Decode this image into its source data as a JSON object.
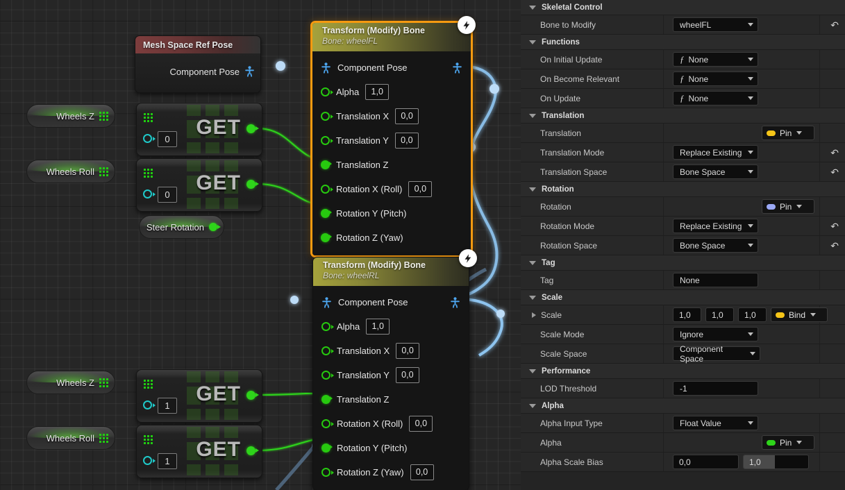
{
  "graph": {
    "variables": [
      {
        "name": "Wheels Z",
        "pin": "array-grid-pin"
      },
      {
        "name": "Wheels Roll",
        "pin": "array-grid-pin"
      },
      {
        "name": "Steer Rotation",
        "pin": "float-dot-pin"
      },
      {
        "name": "Wheels Z",
        "pin": "array-grid-pin"
      },
      {
        "name": "Wheels Roll",
        "pin": "array-grid-pin"
      }
    ],
    "get_nodes": [
      {
        "label": "GET",
        "index": "0"
      },
      {
        "label": "GET",
        "index": "0"
      },
      {
        "label": "GET",
        "index": "1"
      },
      {
        "label": "GET",
        "index": "1"
      }
    ],
    "ref_pose_node": {
      "title": "Mesh Space Ref Pose",
      "out_pin_label": "Component Pose"
    },
    "transform_nodes": [
      {
        "title": "Transform (Modify) Bone",
        "subtitle": "Bone: wheelFL",
        "selected": true,
        "pose_in": "Component Pose",
        "pins": [
          {
            "label": "Alpha",
            "value": "1,0",
            "connected": false
          },
          {
            "label": "Translation X",
            "value": "0,0",
            "connected": false
          },
          {
            "label": "Translation Y",
            "value": "0,0",
            "connected": false
          },
          {
            "label": "Translation Z",
            "value": null,
            "connected": true
          },
          {
            "label": "Rotation X (Roll)",
            "value": "0,0",
            "connected": false
          },
          {
            "label": "Rotation Y (Pitch)",
            "value": null,
            "connected": true
          },
          {
            "label": "Rotation Z (Yaw)",
            "value": null,
            "connected": true
          }
        ]
      },
      {
        "title": "Transform (Modify) Bone",
        "subtitle": "Bone: wheelRL",
        "selected": false,
        "pose_in": "Component Pose",
        "pins": [
          {
            "label": "Alpha",
            "value": "1,0",
            "connected": false
          },
          {
            "label": "Translation X",
            "value": "0,0",
            "connected": false
          },
          {
            "label": "Translation Y",
            "value": "0,0",
            "connected": false
          },
          {
            "label": "Translation Z",
            "value": null,
            "connected": true
          },
          {
            "label": "Rotation X (Roll)",
            "value": "0,0",
            "connected": false
          },
          {
            "label": "Rotation Y (Pitch)",
            "value": null,
            "connected": true
          },
          {
            "label": "Rotation Z (Yaw)",
            "value": "0,0",
            "connected": false
          }
        ]
      }
    ]
  },
  "details": {
    "sections": [
      {
        "title": "Skeletal Control",
        "rows": [
          {
            "name": "Bone to Modify",
            "type": "combo",
            "value": "wheelFL",
            "revert": true
          }
        ]
      },
      {
        "title": "Functions",
        "rows": [
          {
            "name": "On Initial Update",
            "type": "func-combo",
            "value": "None",
            "revert": false
          },
          {
            "name": "On Become Relevant",
            "type": "func-combo",
            "value": "None",
            "revert": false
          },
          {
            "name": "On Update",
            "type": "func-combo",
            "value": "None",
            "revert": false
          }
        ]
      },
      {
        "title": "Translation",
        "rows": [
          {
            "name": "Translation",
            "type": "pin",
            "value": "Pin",
            "color": "#f5c518",
            "revert": false
          },
          {
            "name": "Translation Mode",
            "type": "combo",
            "value": "Replace Existing",
            "revert": true
          },
          {
            "name": "Translation Space",
            "type": "combo",
            "value": "Bone Space",
            "revert": true
          }
        ]
      },
      {
        "title": "Rotation",
        "rows": [
          {
            "name": "Rotation",
            "type": "pin",
            "value": "Pin",
            "color": "#9aa8f5",
            "revert": false
          },
          {
            "name": "Rotation Mode",
            "type": "combo",
            "value": "Replace Existing",
            "revert": true
          },
          {
            "name": "Rotation Space",
            "type": "combo",
            "value": "Bone Space",
            "revert": true
          }
        ]
      },
      {
        "title": "Tag",
        "rows": [
          {
            "name": "Tag",
            "type": "text",
            "value": "None",
            "revert": false
          }
        ]
      },
      {
        "title": "Scale",
        "rows": [
          {
            "name": "Scale",
            "type": "vector-bind",
            "values": [
              "1,0",
              "1,0",
              "1,0"
            ],
            "bind_label": "Bind",
            "color": "#f5c518",
            "expandable": true,
            "revert": false
          },
          {
            "name": "Scale Mode",
            "type": "combo",
            "value": "Ignore",
            "revert": false
          },
          {
            "name": "Scale Space",
            "type": "combo",
            "value": "Component Space",
            "revert": false
          }
        ]
      },
      {
        "title": "Performance",
        "rows": [
          {
            "name": "LOD Threshold",
            "type": "text",
            "value": "-1",
            "revert": false
          }
        ]
      },
      {
        "title": "Alpha",
        "rows": [
          {
            "name": "Alpha Input Type",
            "type": "combo",
            "value": "Float Value",
            "revert": false
          },
          {
            "name": "Alpha",
            "type": "pin",
            "value": "Pin",
            "color": "#2ed41a",
            "revert": false
          },
          {
            "name": "Alpha Scale Bias",
            "type": "dual-num",
            "values": [
              "0,0",
              "1,0"
            ],
            "revert": false
          }
        ]
      }
    ]
  }
}
